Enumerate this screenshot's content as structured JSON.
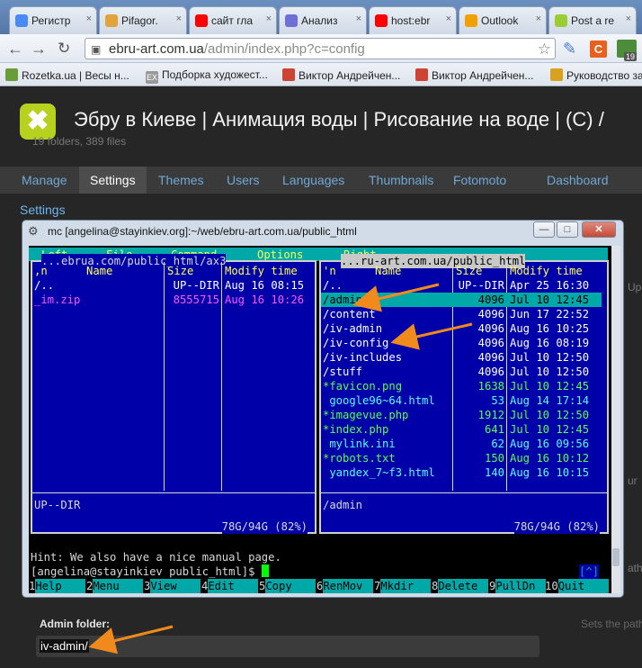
{
  "browser": {
    "tabs": [
      {
        "title": "Регистр",
        "icon": "chrome-icon",
        "color": "#4a8af4"
      },
      {
        "title": "Pifagor.",
        "icon": "chrome-icon",
        "color": "#e2a33b"
      },
      {
        "title": "сайт гла",
        "icon": "yandex-icon",
        "color": "#ff0000"
      },
      {
        "title": "Анализ",
        "icon": "page-icon",
        "color": "#6f6fd8"
      },
      {
        "title": "host:ebr",
        "icon": "yandex-icon",
        "color": "#ff0000"
      },
      {
        "title": "Outlook",
        "icon": "outlook-icon",
        "color": "#f0a000"
      },
      {
        "title": "Post a re",
        "icon": "site-icon",
        "color": "#9acd32"
      }
    ],
    "url_host": "ebru-art.com.ua",
    "url_path": "/admin/index.php?c=config",
    "bookmarks": [
      "Rozetka.ua | Весы н...",
      "Подборка художест...",
      "Виктор Андрейчен...",
      "Виктор Андрейчен...",
      "Руководство за"
    ],
    "badge": "19"
  },
  "page": {
    "title": "Эбру в Киеве | Анимация воды | Рисование на воде | (С) /",
    "stats": "19 folders, 389 files",
    "nav": [
      "Manage",
      "Settings",
      "Themes",
      "Users",
      "Languages",
      "Thumbnails",
      "Fotomoto",
      "Dashboard"
    ],
    "active_nav": "Settings",
    "breadcrumb": "Settings",
    "admin_label": "Admin folder:",
    "admin_value": "iv-admin/",
    "side_hint": "Sets the path",
    "side_frag": [
      "Up",
      "ur",
      "ath"
    ]
  },
  "mc_window": {
    "title": "mc [angelina@stayinkiev.org]:~/web/ebru-art.com.ua/public_html",
    "menu": [
      "Left",
      "File",
      "Command",
      "Options",
      "Right"
    ],
    "left_panel": {
      "path": "...ebrua.com/public_html/ax3",
      "headers": [
        ",n",
        "Name",
        "Size",
        "Modify time"
      ],
      "rows": [
        {
          "name": "/..",
          "size": "UP--DIR",
          "time": "Aug 16 08:15",
          "type": "dir"
        },
        {
          "name": "_im.zip",
          "size": "8555715",
          "time": "Aug 16 10:26",
          "type": "arc"
        }
      ],
      "footer": "UP--DIR",
      "disk": "78G/94G (82%)"
    },
    "right_panel": {
      "path": "...ru-art.com.ua/public_html",
      "headers": [
        "'n",
        "Name",
        "Size",
        "Modify time"
      ],
      "rows": [
        {
          "name": "/..",
          "size": "UP--DIR",
          "time": "Apr 25 16:30",
          "type": "dir"
        },
        {
          "name": "/admin",
          "size": "4096",
          "time": "Jul 10 12:45",
          "type": "sel"
        },
        {
          "name": "/content",
          "size": "4096",
          "time": "Jun 17 22:52",
          "type": "dir"
        },
        {
          "name": "/iv-admin",
          "size": "4096",
          "time": "Aug 16 10:25",
          "type": "dir"
        },
        {
          "name": "/iv-config",
          "size": "4096",
          "time": "Aug 16 08:19",
          "type": "dir"
        },
        {
          "name": "/iv-includes",
          "size": "4096",
          "time": "Jul 10 12:50",
          "type": "dir"
        },
        {
          "name": "/stuff",
          "size": "4096",
          "time": "Jul 10 12:50",
          "type": "dir"
        },
        {
          "name": "*favicon.png",
          "size": "1638",
          "time": "Jul 10 12:45",
          "type": "exe"
        },
        {
          "name": " google96~64.html",
          "size": "53",
          "time": "Aug 14 17:14",
          "type": "fil"
        },
        {
          "name": "*imagevue.php",
          "size": "1912",
          "time": "Jul 10 12:50",
          "type": "exe"
        },
        {
          "name": "*index.php",
          "size": "641",
          "time": "Jul 10 12:45",
          "type": "exe"
        },
        {
          "name": " mylink.ini",
          "size": "62",
          "time": "Aug 16 09:56",
          "type": "fil"
        },
        {
          "name": "*robots.txt",
          "size": "150",
          "time": "Aug 16 10:12",
          "type": "exe"
        },
        {
          "name": " yandex_7~f3.html",
          "size": "140",
          "time": "Aug 16 10:15",
          "type": "fil"
        }
      ],
      "footer": "/admin",
      "disk": "78G/94G (82%)"
    },
    "hint": "Hint: We also have a nice manual page.",
    "prompt": "[angelina@stayinkiev public_html]$ ",
    "prompt_bracket": "[^]",
    "fkeys": [
      {
        "n": "1",
        "l": "Help"
      },
      {
        "n": "2",
        "l": "Menu"
      },
      {
        "n": "3",
        "l": "View"
      },
      {
        "n": "4",
        "l": "Edit"
      },
      {
        "n": "5",
        "l": "Copy"
      },
      {
        "n": "6",
        "l": "RenMov"
      },
      {
        "n": "7",
        "l": "Mkdir"
      },
      {
        "n": "8",
        "l": "Delete"
      },
      {
        "n": "9",
        "l": "PullDn"
      },
      {
        "n": "10",
        "l": "Quit"
      }
    ]
  }
}
